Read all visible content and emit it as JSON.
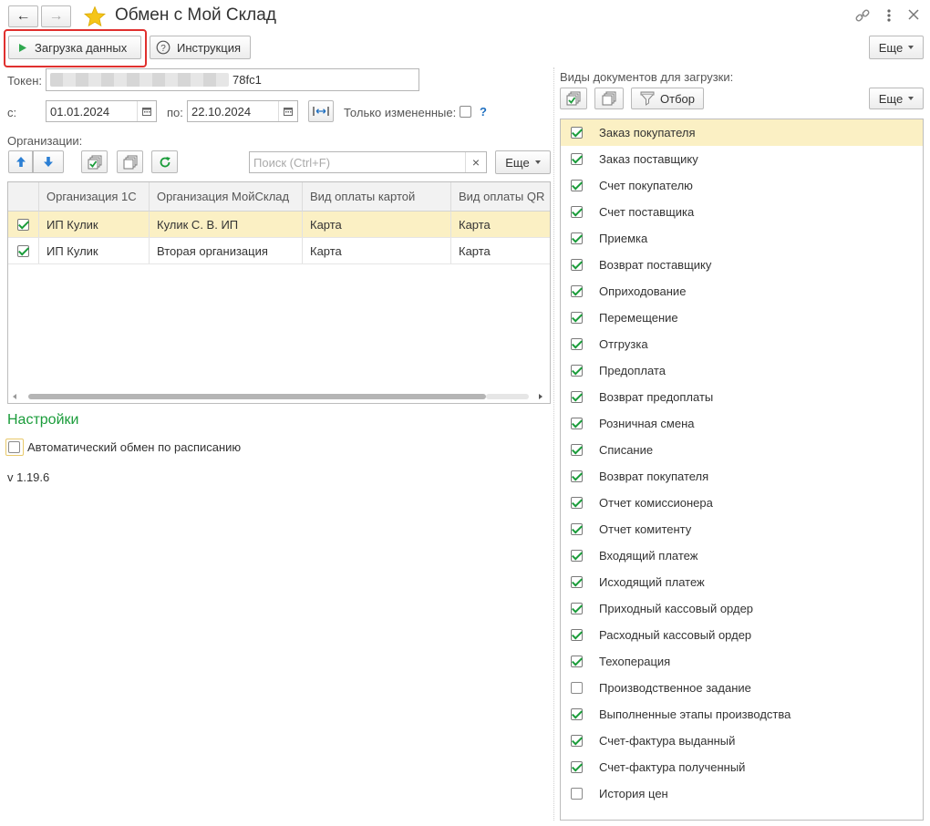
{
  "window": {
    "title": "Обмен с Мой Склад",
    "nav_back": "←",
    "nav_forward": "→",
    "more_label": "Еще"
  },
  "toolbar": {
    "load_label": "Загрузка данных",
    "help_label": "Инструкция"
  },
  "token": {
    "label": "Токен:",
    "value_visible": "78fc1"
  },
  "period": {
    "from_label": "с:",
    "from_value": "01.01.2024",
    "to_label": "по:",
    "to_value": "22.10.2024",
    "only_changed_label": "Только измененные:",
    "only_changed_checked": false,
    "help_mark": "?"
  },
  "orgs": {
    "label": "Организации:",
    "search_placeholder": "Поиск (Ctrl+F)",
    "clear_glyph": "×",
    "more_label": "Еще",
    "columns": [
      "Организация 1С",
      "Организация МойСклад",
      "Вид оплаты картой",
      "Вид оплаты QR"
    ],
    "rows": [
      {
        "checked": true,
        "cells": [
          "ИП Кулик",
          "Кулик С. В. ИП",
          "Карта",
          "Карта"
        ]
      },
      {
        "checked": true,
        "cells": [
          "ИП Кулик",
          "Вторая организация",
          "Карта",
          "Карта"
        ]
      }
    ]
  },
  "settings": {
    "title": "Настройки",
    "auto_exchange_label": "Автоматический обмен по расписанию",
    "auto_exchange_checked": false,
    "version": "v 1.19.6"
  },
  "docs": {
    "label": "Виды документов для загрузки:",
    "filter_label": "Отбор",
    "more_label": "Еще",
    "items": [
      {
        "label": "Заказ покупателя",
        "checked": true
      },
      {
        "label": "Заказ поставщику",
        "checked": true
      },
      {
        "label": "Счет покупателю",
        "checked": true
      },
      {
        "label": "Счет поставщика",
        "checked": true
      },
      {
        "label": "Приемка",
        "checked": true
      },
      {
        "label": "Возврат поставщику",
        "checked": true
      },
      {
        "label": "Оприходование",
        "checked": true
      },
      {
        "label": "Перемещение",
        "checked": true
      },
      {
        "label": "Отгрузка",
        "checked": true
      },
      {
        "label": "Предоплата",
        "checked": true
      },
      {
        "label": "Возврат предоплаты",
        "checked": true
      },
      {
        "label": "Розничная смена",
        "checked": true
      },
      {
        "label": "Списание",
        "checked": true
      },
      {
        "label": "Возврат покупателя",
        "checked": true
      },
      {
        "label": "Отчет комиссионера",
        "checked": true
      },
      {
        "label": "Отчет комитенту",
        "checked": true
      },
      {
        "label": "Входящий платеж",
        "checked": true
      },
      {
        "label": "Исходящий платеж",
        "checked": true
      },
      {
        "label": "Приходный кассовый ордер",
        "checked": true
      },
      {
        "label": "Расходный кассовый ордер",
        "checked": true
      },
      {
        "label": "Техоперация",
        "checked": true
      },
      {
        "label": "Производственное задание",
        "checked": false
      },
      {
        "label": "Выполненные этапы производства",
        "checked": true
      },
      {
        "label": "Счет-фактура выданный",
        "checked": true
      },
      {
        "label": "Счет-фактура полученный",
        "checked": true
      },
      {
        "label": "История цен",
        "checked": false
      }
    ]
  },
  "colors": {
    "accent_green": "#1a9c3a",
    "highlight_row": "#fbf0c4",
    "annotation_red": "#e0302e",
    "star": "#f5c518"
  }
}
